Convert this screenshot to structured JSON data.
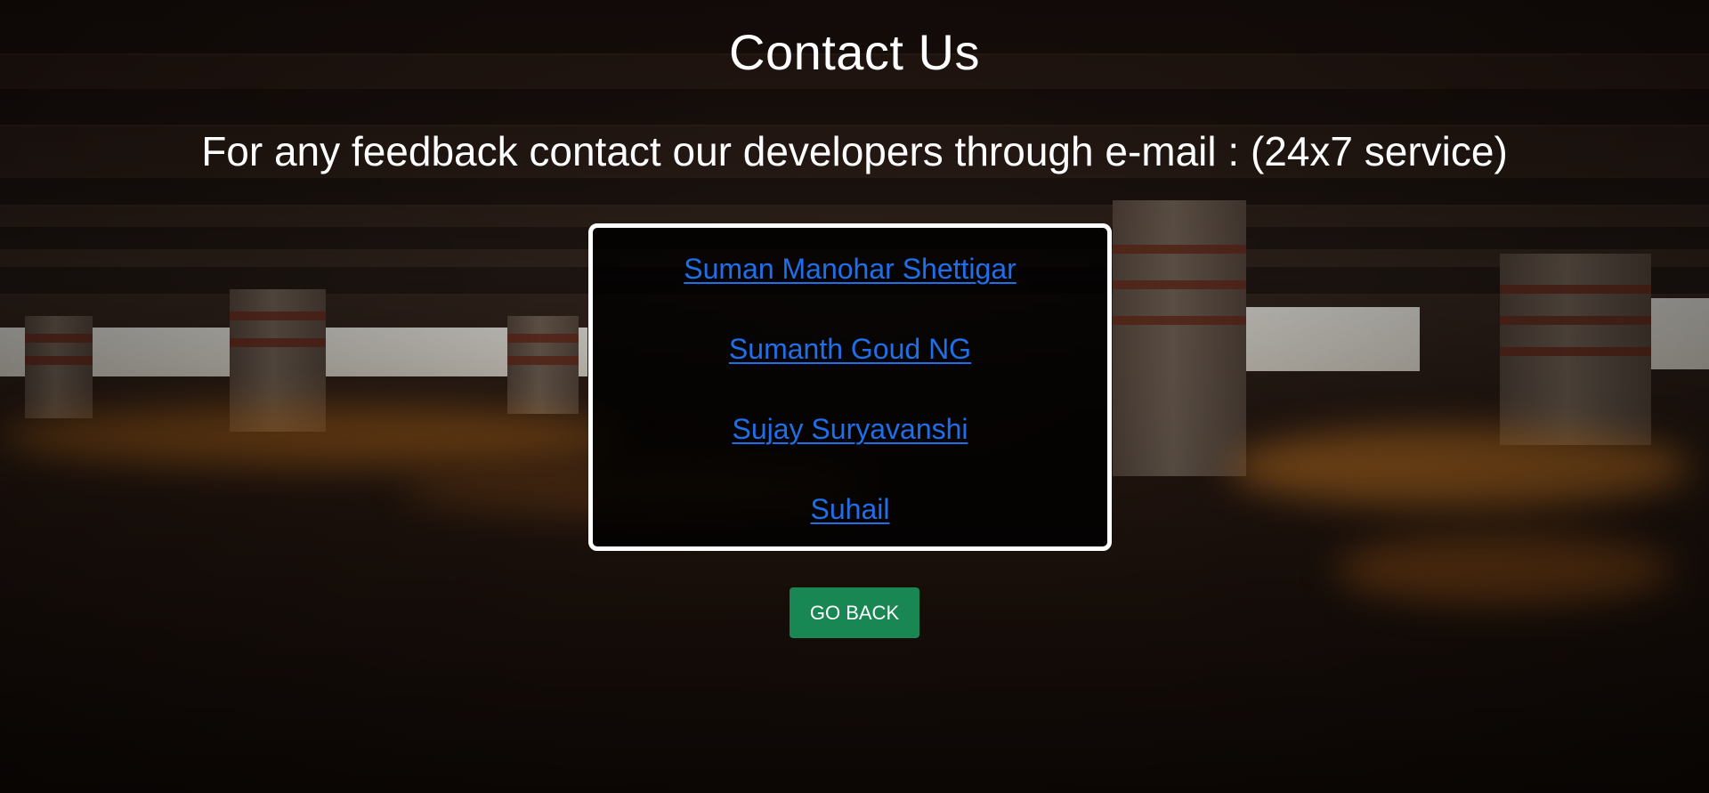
{
  "page": {
    "title": "Contact Us",
    "subtitle": "For any feedback contact our developers through e-mail : (24x7 service)"
  },
  "contacts": [
    {
      "name": "Suman Manohar Shettigar"
    },
    {
      "name": "Sumanth Goud NG"
    },
    {
      "name": "Sujay Suryavanshi"
    },
    {
      "name": "Suhail"
    }
  ],
  "actions": {
    "go_back_label": "GO BACK"
  },
  "colors": {
    "link": "#1f6feb",
    "button": "#198754",
    "box_border": "#ffffff",
    "text": "#ffffff"
  }
}
